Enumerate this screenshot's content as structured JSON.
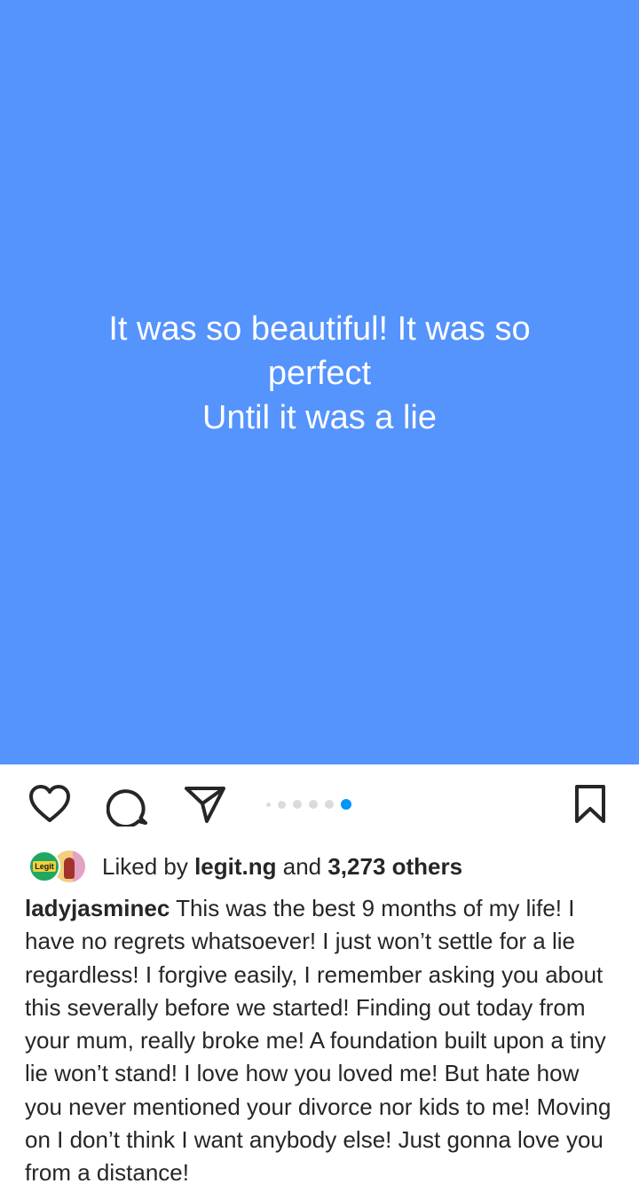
{
  "post": {
    "background_color": "#5593fd",
    "text_lines": "It was so beautiful! It was so perfect\nUntil it was a lie"
  },
  "actions": {
    "like_icon": "heart-outline-icon",
    "comment_icon": "comment-bubble-icon",
    "share_icon": "paper-plane-icon",
    "save_icon": "bookmark-outline-icon"
  },
  "carousel": {
    "total": 6,
    "active_index": 5,
    "active_color": "#0095f6",
    "inactive_color": "#dbdbdb"
  },
  "likes": {
    "prefix": "Liked by ",
    "user": "legit.ng",
    "middle": " and ",
    "count": "3,273 others",
    "avatar_a_label": "Legit"
  },
  "caption": {
    "username": "ladyjasminec",
    "text": "This was the best 9 months of my life! I have no regrets whatsoever! I just won’t settle for a lie regardless! I  forgive easily, I remember asking you about this severally before we started! Finding out today from your mum, really broke me! A foundation built upon a tiny lie won’t stand! I love how you loved me! But hate how you never mentioned your divorce nor kids to me! Moving on I don’t think I want anybody else! Just gonna love you from a distance!"
  }
}
